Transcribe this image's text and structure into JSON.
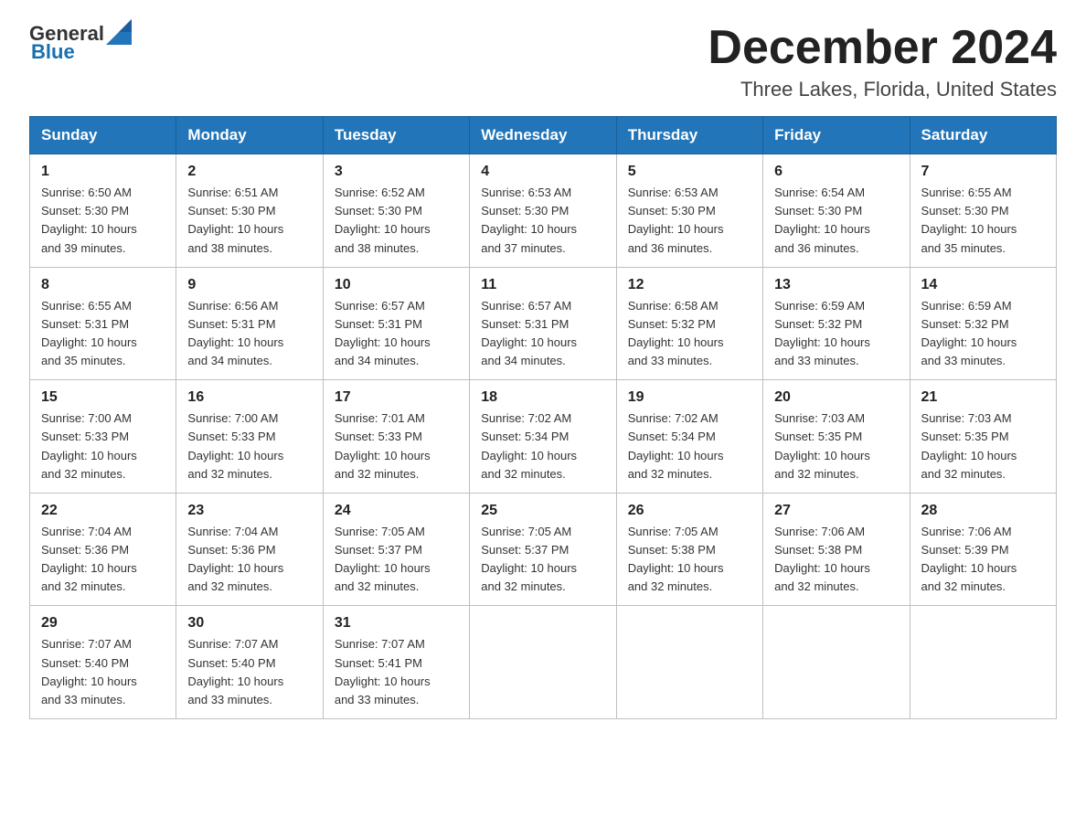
{
  "logo": {
    "general": "General",
    "blue": "Blue"
  },
  "header": {
    "month": "December 2024",
    "location": "Three Lakes, Florida, United States"
  },
  "weekdays": [
    "Sunday",
    "Monday",
    "Tuesday",
    "Wednesday",
    "Thursday",
    "Friday",
    "Saturday"
  ],
  "weeks": [
    [
      {
        "day": "1",
        "sunrise": "6:50 AM",
        "sunset": "5:30 PM",
        "daylight": "10 hours and 39 minutes."
      },
      {
        "day": "2",
        "sunrise": "6:51 AM",
        "sunset": "5:30 PM",
        "daylight": "10 hours and 38 minutes."
      },
      {
        "day": "3",
        "sunrise": "6:52 AM",
        "sunset": "5:30 PM",
        "daylight": "10 hours and 38 minutes."
      },
      {
        "day": "4",
        "sunrise": "6:53 AM",
        "sunset": "5:30 PM",
        "daylight": "10 hours and 37 minutes."
      },
      {
        "day": "5",
        "sunrise": "6:53 AM",
        "sunset": "5:30 PM",
        "daylight": "10 hours and 36 minutes."
      },
      {
        "day": "6",
        "sunrise": "6:54 AM",
        "sunset": "5:30 PM",
        "daylight": "10 hours and 36 minutes."
      },
      {
        "day": "7",
        "sunrise": "6:55 AM",
        "sunset": "5:30 PM",
        "daylight": "10 hours and 35 minutes."
      }
    ],
    [
      {
        "day": "8",
        "sunrise": "6:55 AM",
        "sunset": "5:31 PM",
        "daylight": "10 hours and 35 minutes."
      },
      {
        "day": "9",
        "sunrise": "6:56 AM",
        "sunset": "5:31 PM",
        "daylight": "10 hours and 34 minutes."
      },
      {
        "day": "10",
        "sunrise": "6:57 AM",
        "sunset": "5:31 PM",
        "daylight": "10 hours and 34 minutes."
      },
      {
        "day": "11",
        "sunrise": "6:57 AM",
        "sunset": "5:31 PM",
        "daylight": "10 hours and 34 minutes."
      },
      {
        "day": "12",
        "sunrise": "6:58 AM",
        "sunset": "5:32 PM",
        "daylight": "10 hours and 33 minutes."
      },
      {
        "day": "13",
        "sunrise": "6:59 AM",
        "sunset": "5:32 PM",
        "daylight": "10 hours and 33 minutes."
      },
      {
        "day": "14",
        "sunrise": "6:59 AM",
        "sunset": "5:32 PM",
        "daylight": "10 hours and 33 minutes."
      }
    ],
    [
      {
        "day": "15",
        "sunrise": "7:00 AM",
        "sunset": "5:33 PM",
        "daylight": "10 hours and 32 minutes."
      },
      {
        "day": "16",
        "sunrise": "7:00 AM",
        "sunset": "5:33 PM",
        "daylight": "10 hours and 32 minutes."
      },
      {
        "day": "17",
        "sunrise": "7:01 AM",
        "sunset": "5:33 PM",
        "daylight": "10 hours and 32 minutes."
      },
      {
        "day": "18",
        "sunrise": "7:02 AM",
        "sunset": "5:34 PM",
        "daylight": "10 hours and 32 minutes."
      },
      {
        "day": "19",
        "sunrise": "7:02 AM",
        "sunset": "5:34 PM",
        "daylight": "10 hours and 32 minutes."
      },
      {
        "day": "20",
        "sunrise": "7:03 AM",
        "sunset": "5:35 PM",
        "daylight": "10 hours and 32 minutes."
      },
      {
        "day": "21",
        "sunrise": "7:03 AM",
        "sunset": "5:35 PM",
        "daylight": "10 hours and 32 minutes."
      }
    ],
    [
      {
        "day": "22",
        "sunrise": "7:04 AM",
        "sunset": "5:36 PM",
        "daylight": "10 hours and 32 minutes."
      },
      {
        "day": "23",
        "sunrise": "7:04 AM",
        "sunset": "5:36 PM",
        "daylight": "10 hours and 32 minutes."
      },
      {
        "day": "24",
        "sunrise": "7:05 AM",
        "sunset": "5:37 PM",
        "daylight": "10 hours and 32 minutes."
      },
      {
        "day": "25",
        "sunrise": "7:05 AM",
        "sunset": "5:37 PM",
        "daylight": "10 hours and 32 minutes."
      },
      {
        "day": "26",
        "sunrise": "7:05 AM",
        "sunset": "5:38 PM",
        "daylight": "10 hours and 32 minutes."
      },
      {
        "day": "27",
        "sunrise": "7:06 AM",
        "sunset": "5:38 PM",
        "daylight": "10 hours and 32 minutes."
      },
      {
        "day": "28",
        "sunrise": "7:06 AM",
        "sunset": "5:39 PM",
        "daylight": "10 hours and 32 minutes."
      }
    ],
    [
      {
        "day": "29",
        "sunrise": "7:07 AM",
        "sunset": "5:40 PM",
        "daylight": "10 hours and 33 minutes."
      },
      {
        "day": "30",
        "sunrise": "7:07 AM",
        "sunset": "5:40 PM",
        "daylight": "10 hours and 33 minutes."
      },
      {
        "day": "31",
        "sunrise": "7:07 AM",
        "sunset": "5:41 PM",
        "daylight": "10 hours and 33 minutes."
      },
      null,
      null,
      null,
      null
    ]
  ],
  "labels": {
    "sunrise": "Sunrise:",
    "sunset": "Sunset:",
    "daylight": "Daylight:"
  }
}
